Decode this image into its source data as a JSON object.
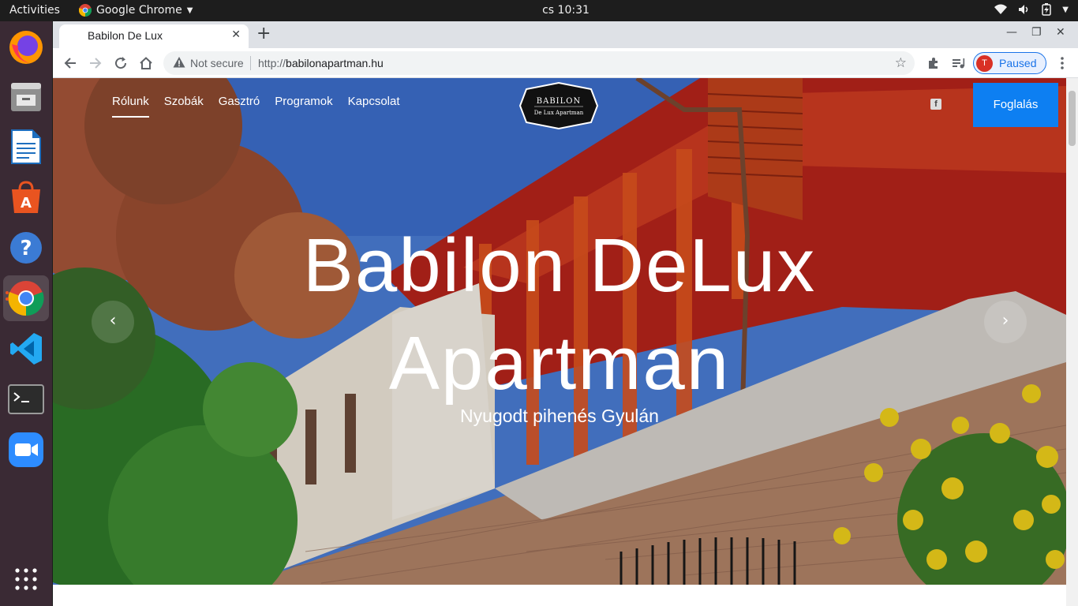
{
  "desktop": {
    "activities": "Activities",
    "app_menu": "Google Chrome",
    "clock": "cs 10:31"
  },
  "dock": {
    "items": [
      {
        "name": "firefox-icon",
        "color": "#ff7139"
      },
      {
        "name": "files-icon",
        "color": "#9a9a9a"
      },
      {
        "name": "libreoffice-writer-icon",
        "color": "#1e6fbf"
      },
      {
        "name": "software-center-icon",
        "color": "#e95420"
      },
      {
        "name": "help-icon",
        "color": "#3b7bd4"
      },
      {
        "name": "chrome-icon",
        "color": "#4285f4"
      },
      {
        "name": "vscode-icon",
        "color": "#23a9f2"
      },
      {
        "name": "terminal-icon",
        "color": "#2c2c2c"
      },
      {
        "name": "zoom-icon",
        "color": "#2d8cff"
      },
      {
        "name": "show-apps-icon",
        "color": "#ffffff"
      }
    ]
  },
  "browser": {
    "tab_title": "Babilon De Lux",
    "not_secure": "Not secure",
    "url_scheme": "http://",
    "url_host": "babilonapartman.hu",
    "profile_initial": "T",
    "profile_status": "Paused"
  },
  "site": {
    "nav": [
      "Rólunk",
      "Szobák",
      "Gasztró",
      "Programok",
      "Kapcsolat"
    ],
    "logo_line1": "BABILON",
    "logo_line2": "De Lux Apartman",
    "booking": "Foglalás",
    "hero_title_line1": "Babilon DeLux",
    "hero_title_line2": "Apartman",
    "hero_subtitle": "Nyugodt pihenés Gyulán",
    "accent_color": "#0d7ff2"
  }
}
